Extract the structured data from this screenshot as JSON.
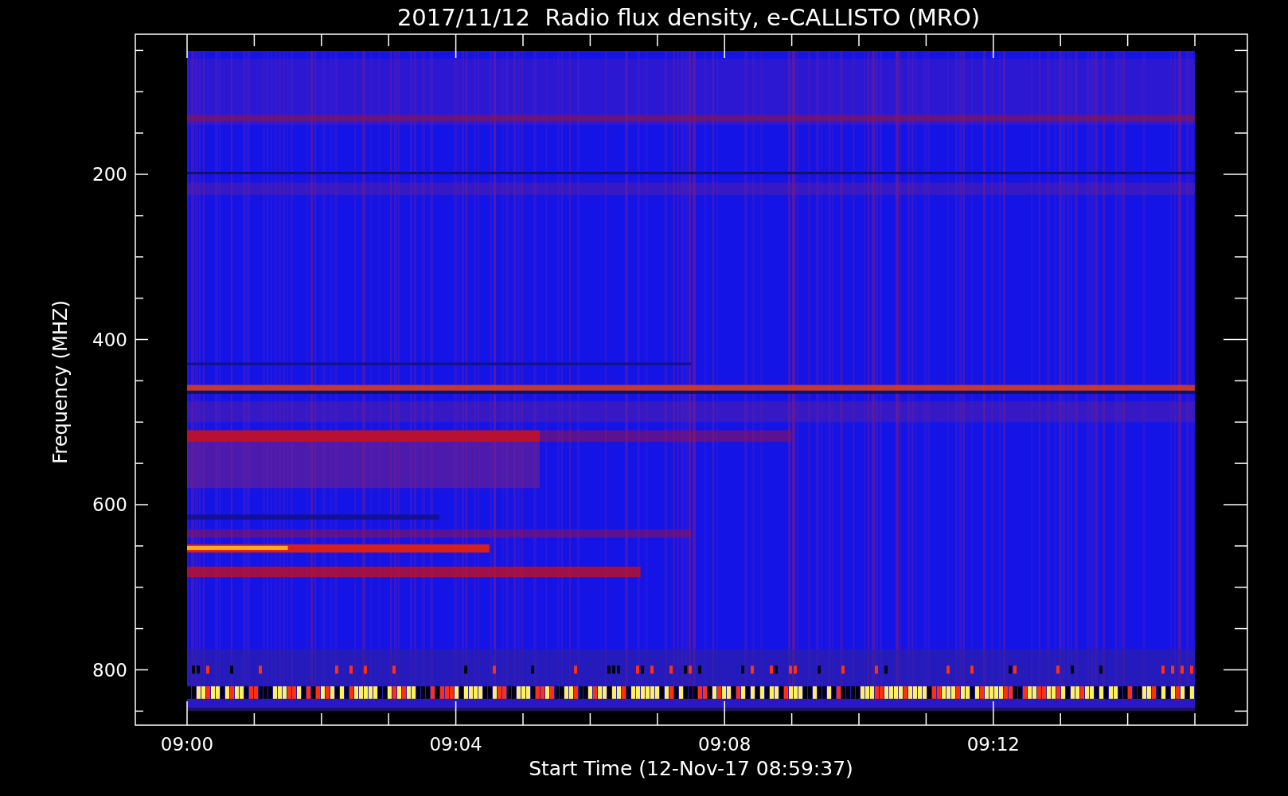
{
  "title": "2017/11/12  Radio flux density, e-CALLISTO (MRO)",
  "y_axis": {
    "title": "Frequency (MHZ)",
    "tick_labels": [
      "200",
      "400",
      "600",
      "800"
    ]
  },
  "x_axis": {
    "title": "Start Time (12-Nov-17 08:59:37)",
    "tick_labels": [
      "09:00",
      "09:04",
      "09:08",
      "09:12"
    ]
  }
}
